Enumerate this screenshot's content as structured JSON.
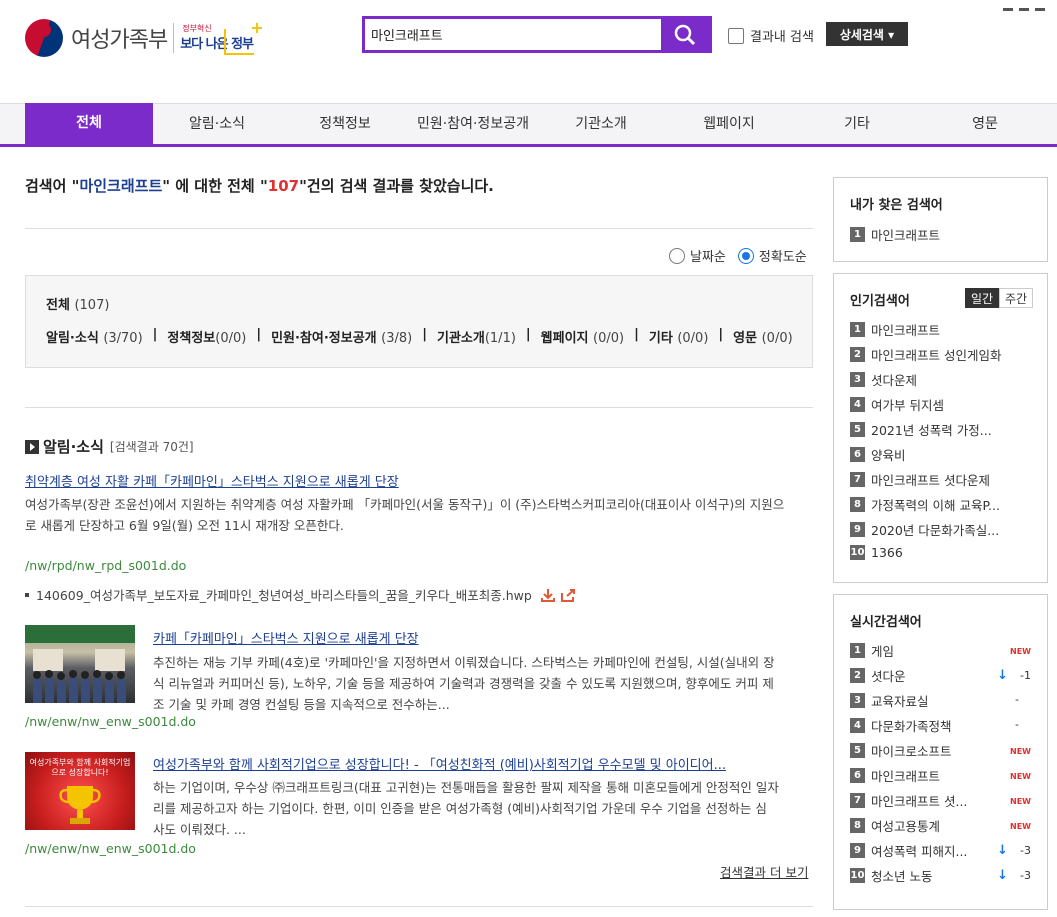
{
  "header": {
    "logo_text": "여성가족부",
    "logo_sub_top": "정부혁신",
    "logo_sub_main": "보다 나은 정부",
    "search_value": "마인크래프트",
    "within_results_label": "결과내 검색",
    "detail_search_label": "상세검색 ▾"
  },
  "nav": {
    "tabs": [
      "전체",
      "알림·소식",
      "정책정보",
      "민원·참여·정보공개",
      "기관소개",
      "웹페이지",
      "기타",
      "영문"
    ]
  },
  "summary": {
    "prefix": "검색어 \"",
    "query": "마인크래프트",
    "middle": "\" 에 대한 전체 \"",
    "count": "107",
    "suffix": "\"건의 검색 결과를 찾았습니다."
  },
  "sort": {
    "options": [
      "날짜순",
      "정확도순"
    ],
    "selected": "정확도순"
  },
  "categories": {
    "total_label": "전체",
    "total_count": "(107)",
    "items": [
      {
        "label": "알림·소식",
        "count": "(3/70)"
      },
      {
        "label": "정책정보",
        "count": "(0/0)"
      },
      {
        "label": "민원·참여·정보공개",
        "count": "(3/8)"
      },
      {
        "label": "기관소개",
        "count": "(1/1)"
      },
      {
        "label": "웹페이지",
        "count": "(0/0)"
      },
      {
        "label": "기타",
        "count": "(0/0)"
      },
      {
        "label": "영문",
        "count": "(0/0)"
      }
    ]
  },
  "section": {
    "title": "알림·소식",
    "count": "[검색결과 70건]"
  },
  "results": [
    {
      "title": "취약계층 여성 자활 카페「카페마인」스타벅스 지원으로 새롭게 단장",
      "desc1": "여성가족부(장관 조윤선)에서 지원하는 취약계층 여성 자활카페 「카페마인(서울 동작구)」이 (주)스타벅스커피코리아(대표이사 이석구)의 지원으",
      "desc2": "로 새롭게 단장하고 6월 9일(월) 오전 11시 재개장 오픈한다.",
      "url": "/nw/rpd/nw_rpd_s001d.do",
      "attachment": "140609_여성가족부_보도자료_카페마인_청년여성_바리스타들의_꿈을_키우다_배포최종.hwp"
    },
    {
      "title": "카페「카페마인」스타벅스 지원으로 새롭게 단장",
      "desc1": "추진하는 재능 기부 카페(4호)로 '카페마인'을 지정하면서 이뤄졌습니다.   스타벅스는 카페마인에 컨설팅, 시설(실내외 장",
      "desc2": "식 리뉴얼과 커피머신 등), 노하우, 기술 등을 제공하여 기술력과 경쟁력을 갖출 수 있도록 지원했으며, 향후에도 커피 제",
      "desc3": "조 기술 및 카페 경영 컨설팅 등을 지속적으로 전수하는...",
      "url": "/nw/enw/nw_enw_s001d.do"
    },
    {
      "title": "여성가족부와 함께 사회적기업으로 성장합니다! - 「여성친화적 (예비)사회적기업 우수모델 및 아이디어...",
      "desc1": "하는 기업이며, 우수상 ㈜크래프트링크(대표 고귀현)는 전통매듭을 활용한 팔찌 제작을 통해 미혼모들에게 안정적인 일자",
      "desc2": "리를 제공하고자 하는 기업이다.   한편, 이미 인증을 받은 여성가족형 (예비)사회적기업 가운데 우수 기업을 선정하는 심",
      "desc3": "사도 이뤄졌다. ...",
      "url": "/nw/enw/nw_enw_s001d.do",
      "thumb_text": "여성가족부와 함께 사회적기업으로 성장합니다!"
    }
  ],
  "more_label": "검색결과 더 보기",
  "sidebar": {
    "my_searches": {
      "title": "내가 찾은 검색어",
      "items": [
        "마인크래프트"
      ]
    },
    "popular": {
      "title": "인기검색어",
      "toggle": [
        "일간",
        "주간"
      ],
      "items": [
        "마인크래프트",
        "마인크래프트 성인게임화",
        "셧다운제",
        "여가부 뒤지셈",
        "2021년 성폭력 가정...",
        "양육비",
        "마인크래프트 셧다운제",
        "가정폭력의 이해 교육P...",
        "2020년 다문화가족실...",
        "1366"
      ]
    },
    "realtime": {
      "title": "실시간검색어",
      "items": [
        {
          "label": "게임",
          "status": "NEW"
        },
        {
          "label": "셧다운",
          "status": "-1"
        },
        {
          "label": "교육자료실",
          "status": "-"
        },
        {
          "label": "다문화가족정책",
          "status": "-"
        },
        {
          "label": "마이크로소프트",
          "status": "NEW"
        },
        {
          "label": "마인크래프트",
          "status": "NEW"
        },
        {
          "label": "마인크래프트 셧...",
          "status": "NEW"
        },
        {
          "label": "여성고용통계",
          "status": "NEW"
        },
        {
          "label": "여성폭력 피해지...",
          "status": "-3"
        },
        {
          "label": "청소년 노동",
          "status": "-3"
        }
      ]
    }
  },
  "colors": {
    "accent": "#7b2bc9",
    "link": "#1c3f94",
    "url": "#3c8a3c",
    "count": "#e03030"
  }
}
